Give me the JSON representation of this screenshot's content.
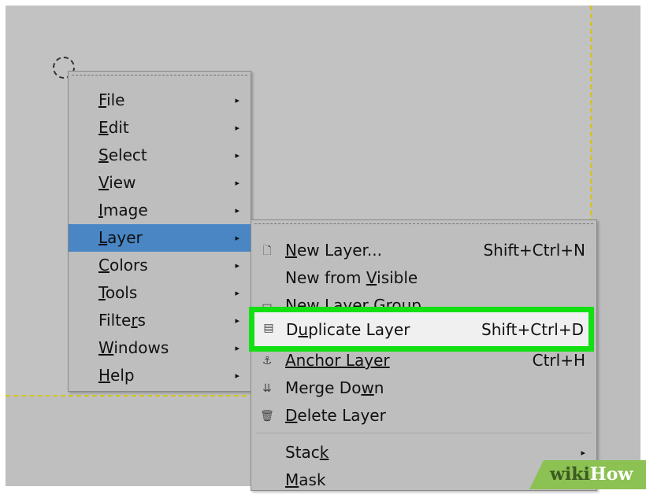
{
  "main_menu": {
    "items": [
      {
        "pre": "",
        "ul": "F",
        "post": "ile"
      },
      {
        "pre": "",
        "ul": "E",
        "post": "dit"
      },
      {
        "pre": "",
        "ul": "S",
        "post": "elect"
      },
      {
        "pre": "",
        "ul": "V",
        "post": "iew"
      },
      {
        "pre": "",
        "ul": "I",
        "post": "mage"
      },
      {
        "pre": "",
        "ul": "L",
        "post": "ayer"
      },
      {
        "pre": "",
        "ul": "C",
        "post": "olors"
      },
      {
        "pre": "",
        "ul": "T",
        "post": "ools"
      },
      {
        "pre": "Filte",
        "ul": "r",
        "post": "s"
      },
      {
        "pre": "",
        "ul": "W",
        "post": "indows"
      },
      {
        "pre": "",
        "ul": "H",
        "post": "elp"
      }
    ],
    "arrow": "▸",
    "highlighted_index": 5
  },
  "layer_menu": {
    "new_layer": {
      "pre": "",
      "ul": "N",
      "post": "ew Layer...",
      "shortcut": "Shift+Ctrl+N",
      "icon": "new-layer-icon",
      "glyph": "🗋"
    },
    "new_from_visible": {
      "pre": "New from ",
      "ul": "V",
      "post": "isible"
    },
    "new_layer_group": {
      "label": "New Layer Group",
      "icon": "layer-group-icon",
      "glyph": "▭"
    },
    "duplicate_layer": {
      "pre": "D",
      "ul": "u",
      "post": "plicate Layer",
      "shortcut": "Shift+Ctrl+D",
      "icon": "duplicate-layer-icon",
      "glyph": "▤"
    },
    "anchor_layer": {
      "label": "Anchor Layer",
      "shortcut": "Ctrl+H",
      "icon": "anchor-icon",
      "glyph": "⚓"
    },
    "merge_down": {
      "pre": "Merge Do",
      "ul": "w",
      "post": "n",
      "icon": "merge-down-icon",
      "glyph": "⇊"
    },
    "delete_layer": {
      "pre": "",
      "ul": "D",
      "post": "elete Layer",
      "icon": "delete-layer-icon",
      "glyph": "🗑"
    },
    "stack": {
      "pre": "Stac",
      "ul": "k",
      "post": ""
    },
    "mask": {
      "pre": "",
      "ul": "M",
      "post": "ask"
    }
  },
  "watermark": {
    "wiki": "wiki",
    "how": "How"
  },
  "colors": {
    "highlight": "#4a86c4",
    "callout_green": "#12e012",
    "canvas": "#c2c2c2",
    "selection_dash": "#d6c31a"
  }
}
